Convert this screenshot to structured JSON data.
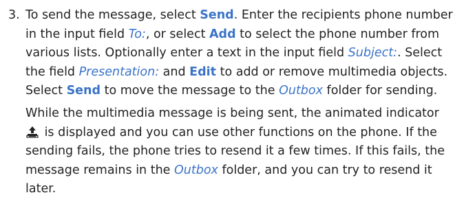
{
  "step": {
    "number": "3.",
    "p1": [
      "To send the message, select ",
      "Send",
      ". Enter the recipients phone number in the input field ",
      "To:",
      ", or select ",
      "Add",
      " to select the phone number from various lists. Optionally enter a text in the input field ",
      "Subject:",
      ". Select the field ",
      "Presentation:",
      " and ",
      "Edit",
      " to add or remove multimedia objects. Select ",
      "Send",
      " to move the message to the ",
      "Outbox",
      " folder for sending."
    ],
    "p2": [
      "While the multimedia message is being sent, the animated indicator ",
      " is displayed and you can use other functions on the phone. If the sending fails, the phone tries to resend it a few times. If this fails, the message remains in the ",
      "Outbox",
      " folder, and you can try to resend it later."
    ],
    "indicator_icon": "sending-indicator-icon"
  },
  "colors": {
    "ui_reference": "#3a73c8",
    "body_text": "#222222"
  }
}
